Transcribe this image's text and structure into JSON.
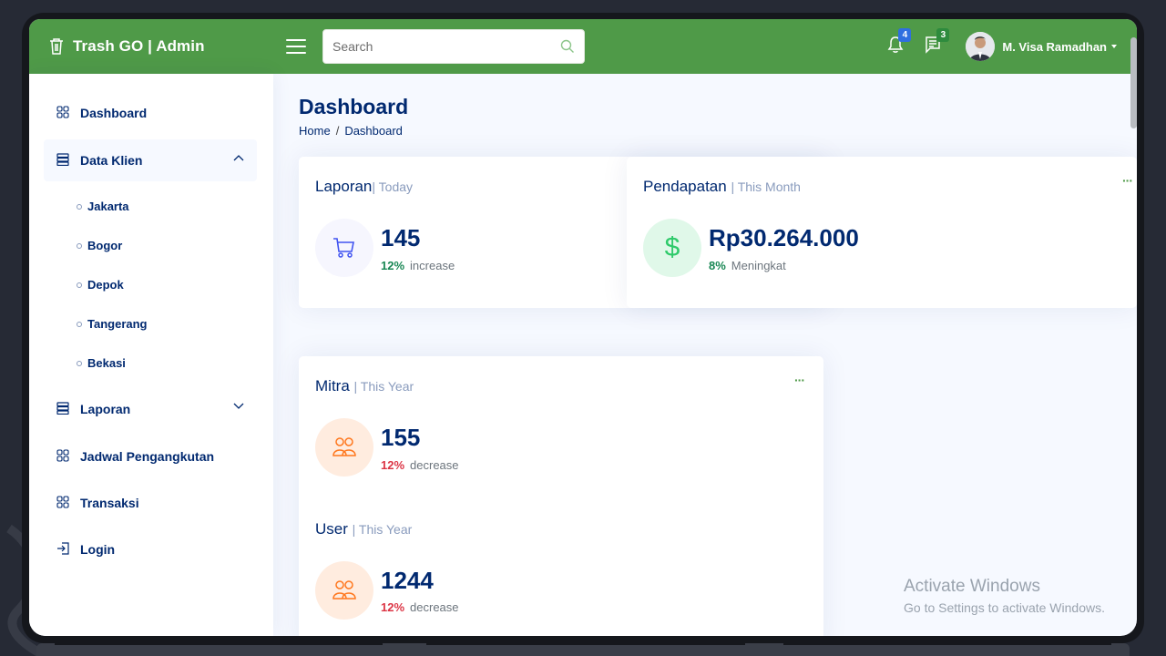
{
  "app": {
    "title": "Trash GO | Admin"
  },
  "search": {
    "placeholder": "Search"
  },
  "notifications": {
    "count": "4",
    "badge_color": "#2f6fe0"
  },
  "messages": {
    "count": "3",
    "badge_color": "#2e8b3d"
  },
  "user": {
    "name": "M. Visa Ramadhan"
  },
  "sidebar": {
    "items": [
      {
        "label": "Dashboard",
        "icon": "grid-icon"
      },
      {
        "label": "Data Klien",
        "icon": "server-icon",
        "expanded": true,
        "children": [
          "Jakarta",
          "Bogor",
          "Depok",
          "Tangerang",
          "Bekasi"
        ]
      },
      {
        "label": "Laporan",
        "icon": "server-icon",
        "expanded": false
      },
      {
        "label": "Jadwal Pengangkutan",
        "icon": "grid-icon"
      },
      {
        "label": "Transaksi",
        "icon": "grid-icon"
      },
      {
        "label": "Login",
        "icon": "login-icon"
      }
    ]
  },
  "page": {
    "title": "Dashboard",
    "breadcrumb": [
      "Home",
      "Dashboard"
    ]
  },
  "cards": {
    "laporan": {
      "title": "Laporan",
      "period": "| Today",
      "value": "145",
      "pct": "12%",
      "trend": "increase",
      "pct_color": "#198754",
      "icon": "cart-icon"
    },
    "pendapatan": {
      "title": "Pendapatan",
      "period": "| This Month",
      "value": "Rp30.264.000",
      "pct": "8%",
      "trend": "Meningkat",
      "pct_color": "#198754",
      "icon": "dollar-icon"
    },
    "mitra": {
      "title": "Mitra",
      "period": "| This Year",
      "value": "155",
      "pct": "12%",
      "trend": "decrease",
      "pct_color": "#dc3545",
      "icon": "people-icon"
    },
    "user": {
      "title": "User",
      "period": "| This Year",
      "value": "1244",
      "pct": "12%",
      "trend": "decrease",
      "pct_color": "#dc3545",
      "icon": "people-icon"
    }
  },
  "watermark": {
    "line1": "Activate Windows",
    "line2": "Go to Settings to activate Windows."
  },
  "colors": {
    "header": "#4f9a48",
    "navy": "#012970",
    "muted": "#899bbd"
  }
}
